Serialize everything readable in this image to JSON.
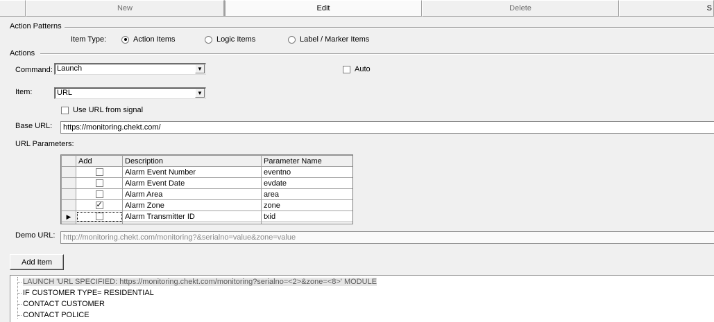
{
  "toolbar": {
    "new_label": "New",
    "edit_label": "Edit",
    "delete_label": "Delete",
    "last_label": "S"
  },
  "action_patterns": {
    "group_label": "Action Patterns",
    "item_type_label": "Item Type:",
    "options": [
      {
        "label": "Action Items",
        "selected": true
      },
      {
        "label": "Logic Items",
        "selected": false
      },
      {
        "label": "Label / Marker Items",
        "selected": false
      }
    ]
  },
  "actions": {
    "group_label": "Actions",
    "command_label": "Command:",
    "command_value": "Launch",
    "auto_label": "Auto",
    "auto_checked": false,
    "item_label": "Item:",
    "item_value": "URL",
    "use_url_label": "Use URL from signal",
    "use_url_checked": false,
    "base_url_label": "Base URL:",
    "base_url_value": "https://monitoring.chekt.com/",
    "url_params_label": "URL Parameters:",
    "grid": {
      "headers": [
        "Add",
        "Description",
        "Parameter Name"
      ],
      "rows": [
        {
          "add": false,
          "description": "Alarm Event Number",
          "param": "eventno",
          "current": false
        },
        {
          "add": false,
          "description": "Alarm Event Date",
          "param": "evdate",
          "current": false
        },
        {
          "add": false,
          "description": "Alarm Area",
          "param": "area",
          "current": false
        },
        {
          "add": true,
          "description": "Alarm Zone",
          "param": "zone",
          "current": false
        },
        {
          "add": false,
          "description": "Alarm Transmitter ID",
          "param": "txid",
          "current": true
        }
      ]
    },
    "demo_url_label": "Demo URL:",
    "demo_url_value": "http://monitoring.chekt.com/monitoring?&serialno=value&zone=value",
    "add_item_label": "Add Item"
  },
  "tree": {
    "items": [
      {
        "text": "LAUNCH 'URL SPECIFIED: https://monitoring.chekt.com/monitoring?serialno=<2>&zone=<8>' MODULE",
        "selected": true
      },
      {
        "text": "IF CUSTOMER TYPE= RESIDENTIAL",
        "selected": false
      },
      {
        "text": "CONTACT CUSTOMER",
        "selected": false
      },
      {
        "text": "CONTACT POLICE",
        "selected": false
      }
    ]
  }
}
